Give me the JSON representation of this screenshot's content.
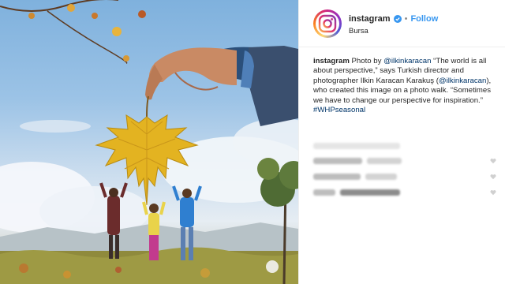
{
  "header": {
    "username": "instagram",
    "separator": "•",
    "follow_label": "Follow",
    "location": "Bursa"
  },
  "caption": {
    "username": "instagram",
    "photo_by": "Photo by",
    "mention_1": "@ilkinkaracan",
    "text_1": "“The world is all about perspective,” says Turkish director and photographer Ilkin Karacan Karakuş (",
    "mention_2": "@ilkinkaracan",
    "text_2": "), who created this image on a photo walk. “Sometimes we have to change our perspective for inspiration.” ",
    "hashtag": "#WHPseasonal"
  },
  "icons": {
    "avatar": "instagram-camera-icon",
    "verified": "verified-badge-icon",
    "like": "heart-icon"
  },
  "colors": {
    "link": "#3897f0",
    "mention": "#003569",
    "leaf": "#e3b321"
  }
}
